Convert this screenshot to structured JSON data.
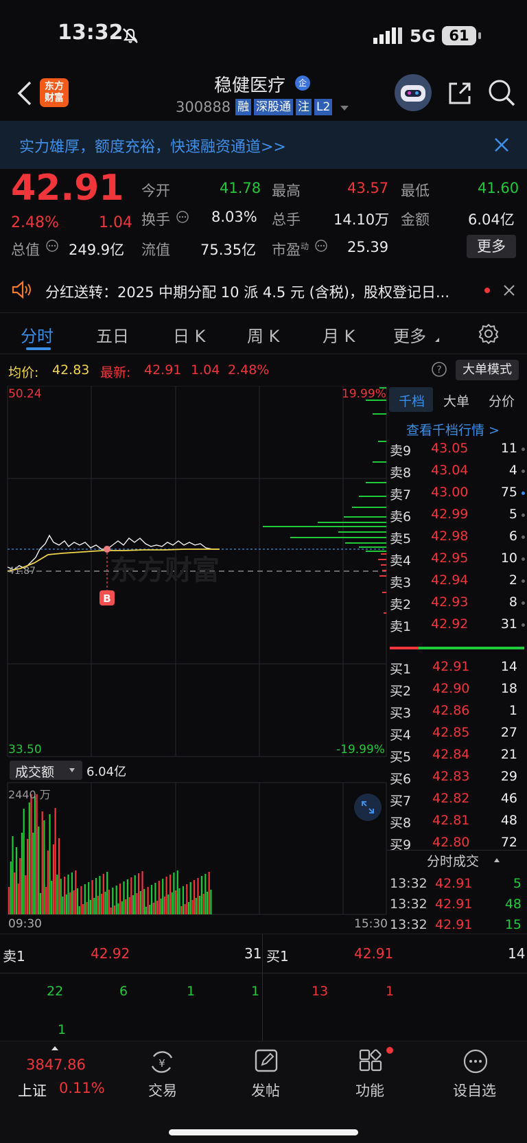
{
  "status": {
    "time": "13:32",
    "network": "5G",
    "battery": "61"
  },
  "header": {
    "name": "稳健医疗",
    "badge": "企",
    "code": "300888",
    "tags": [
      "融",
      "深股通",
      "注",
      "L2"
    ],
    "logo": "东方\n财富"
  },
  "banner": {
    "text": "实力雄厚，额度充裕，快速融资通道>>"
  },
  "quote": {
    "price": "42.91",
    "pct": "2.48%",
    "chg": "1.04",
    "fields": [
      {
        "label": "今开",
        "value": "41.78",
        "color": "green"
      },
      {
        "label": "最高",
        "value": "43.57",
        "color": "red"
      },
      {
        "label": "最低",
        "value": "41.60",
        "color": "green"
      },
      {
        "label": "换手",
        "value": "8.03%",
        "color": "white"
      },
      {
        "label": "总手",
        "value": "14.10万",
        "color": "white"
      },
      {
        "label": "金额",
        "value": "6.04亿",
        "color": "white"
      },
      {
        "label": "总值",
        "value": "249.9亿",
        "color": "white"
      },
      {
        "label": "流值",
        "value": "75.35亿",
        "color": "white"
      },
      {
        "label": "市盈",
        "sup": "动",
        "value": "25.39",
        "color": "white"
      }
    ],
    "more": "更多"
  },
  "notice": {
    "text": "分红送转：2025 中期分配 10 派 4.5 元 (含税)，股权登记日..."
  },
  "tabs": [
    "分时",
    "五日",
    "日 K",
    "周 K",
    "月 K",
    "更多"
  ],
  "chartinfo": {
    "avg_label": "均价:",
    "avg": "42.83",
    "latest_label": "最新:",
    "latest": "42.91",
    "chg": "1.04",
    "pct": "2.48%",
    "big_order": "大单模式"
  },
  "chart_data": {
    "type": "line",
    "ymax": "50.24",
    "ymin": "33.50",
    "pmax": "19.99%",
    "pmin": "-19.99%",
    "prev_close": "41.87",
    "watermark": "东方财富",
    "x_start": "09:30",
    "x_end": "15:30",
    "vol_label": "成交额",
    "vol_total": "6.04亿",
    "vol_max": "2440 万",
    "signal": "B"
  },
  "book": {
    "tabs": [
      "千档",
      "大单",
      "分价"
    ],
    "link": "查看千档行情 >",
    "asks": [
      {
        "label": "卖9",
        "price": "43.05",
        "vol": "11"
      },
      {
        "label": "卖8",
        "price": "43.04",
        "vol": "4"
      },
      {
        "label": "卖7",
        "price": "43.00",
        "vol": "75"
      },
      {
        "label": "卖6",
        "price": "42.99",
        "vol": "5"
      },
      {
        "label": "卖5",
        "price": "42.98",
        "vol": "6"
      },
      {
        "label": "卖4",
        "price": "42.95",
        "vol": "10"
      },
      {
        "label": "卖3",
        "price": "42.94",
        "vol": "2"
      },
      {
        "label": "卖2",
        "price": "42.93",
        "vol": "8"
      },
      {
        "label": "卖1",
        "price": "42.92",
        "vol": "31"
      }
    ],
    "bids": [
      {
        "label": "买1",
        "price": "42.91",
        "vol": "14"
      },
      {
        "label": "买2",
        "price": "42.90",
        "vol": "18"
      },
      {
        "label": "买3",
        "price": "42.86",
        "vol": "1"
      },
      {
        "label": "买4",
        "price": "42.85",
        "vol": "27"
      },
      {
        "label": "买5",
        "price": "42.84",
        "vol": "21"
      },
      {
        "label": "买6",
        "price": "42.83",
        "vol": "29"
      },
      {
        "label": "买7",
        "price": "42.82",
        "vol": "46"
      },
      {
        "label": "买8",
        "price": "42.81",
        "vol": "48"
      },
      {
        "label": "买9",
        "price": "42.80",
        "vol": "72"
      }
    ],
    "ticks_title": "分时成交",
    "ticks": [
      {
        "time": "13:32",
        "price": "42.91",
        "vol": "5",
        "color": "green"
      },
      {
        "time": "13:32",
        "price": "42.91",
        "vol": "48",
        "color": "green"
      },
      {
        "time": "13:32",
        "price": "42.91",
        "vol": "15",
        "color": "green"
      }
    ]
  },
  "level1": {
    "sell_label": "卖1",
    "sell_price": "42.92",
    "sell_vol": "31",
    "buy_label": "买1",
    "buy_price": "42.91",
    "buy_vol": "14",
    "sell_queue": [
      "22",
      "6",
      "1",
      "1",
      "1"
    ],
    "buy_queue": [
      "13",
      "1"
    ]
  },
  "nav": {
    "index_value": "3847.86",
    "index_name": "上证",
    "index_pct": "0.11%",
    "items": [
      "交易",
      "发帖",
      "功能",
      "设自选"
    ]
  }
}
